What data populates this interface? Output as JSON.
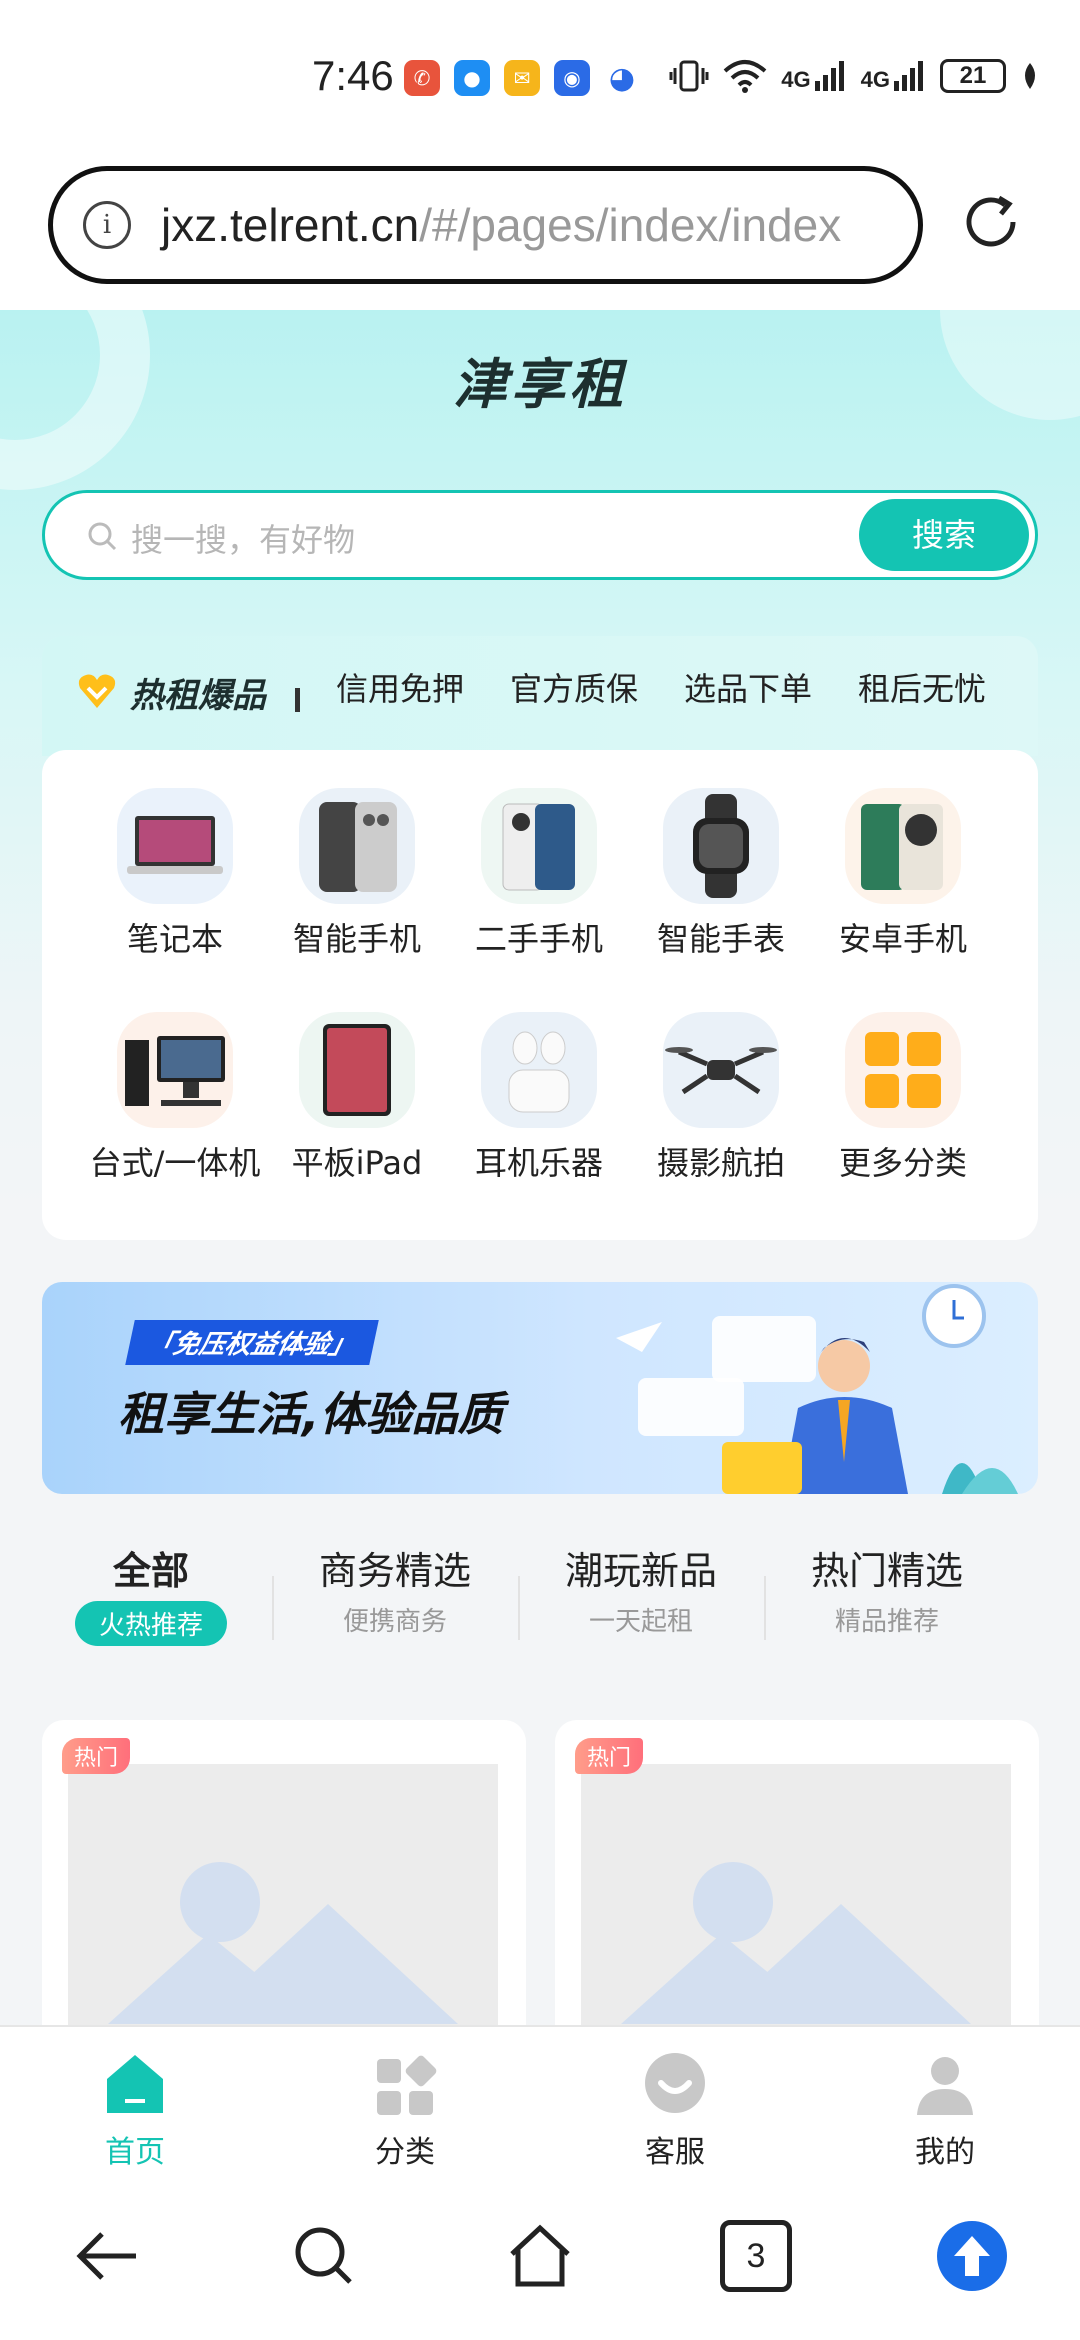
{
  "status_bar": {
    "time": "7:46",
    "net1": "4G",
    "net2": "4G",
    "battery": "21"
  },
  "browser": {
    "url_host": "jxz.telrent.cn",
    "url_path": "/#/pages/index/index",
    "tab_count": "3"
  },
  "page": {
    "brand": "津享租",
    "search_placeholder": "搜一搜，有好物",
    "search_button": "搜索",
    "hot_title": "热租爆品",
    "features": [
      "信用免押",
      "官方质保",
      "选品下单",
      "租后无忧"
    ],
    "categories": [
      {
        "label": "笔记本",
        "icon": "laptop-icon"
      },
      {
        "label": "智能手机",
        "icon": "smartphone-icon"
      },
      {
        "label": "二手手机",
        "icon": "used-phone-icon"
      },
      {
        "label": "智能手表",
        "icon": "smartwatch-icon"
      },
      {
        "label": "安卓手机",
        "icon": "android-phone-icon"
      },
      {
        "label": "台式/一体机",
        "icon": "desktop-icon"
      },
      {
        "label": "平板iPad",
        "icon": "tablet-icon"
      },
      {
        "label": "耳机乐器",
        "icon": "earbuds-icon"
      },
      {
        "label": "摄影航拍",
        "icon": "drone-icon"
      },
      {
        "label": "更多分类",
        "icon": "more-grid-icon"
      }
    ],
    "banner_tag": "「免压权益体验」",
    "banner_text": "租享生活,体验品质",
    "tabs": [
      {
        "title": "全部",
        "sub": "火热推荐"
      },
      {
        "title": "商务精选",
        "sub": "便携商务"
      },
      {
        "title": "潮玩新品",
        "sub": "一天起租"
      },
      {
        "title": "热门精选",
        "sub": "精品推荐"
      }
    ],
    "products": [
      {
        "badge": "热门"
      },
      {
        "badge": "热门"
      }
    ]
  },
  "tabbar": {
    "items": [
      {
        "label": "首页",
        "icon": "home-icon"
      },
      {
        "label": "分类",
        "icon": "category-icon"
      },
      {
        "label": "客服",
        "icon": "customer-service-icon"
      },
      {
        "label": "我的",
        "icon": "profile-icon"
      }
    ]
  },
  "colors": {
    "accent": "#14c4b3",
    "browser_up_button": "#1a6de8"
  }
}
